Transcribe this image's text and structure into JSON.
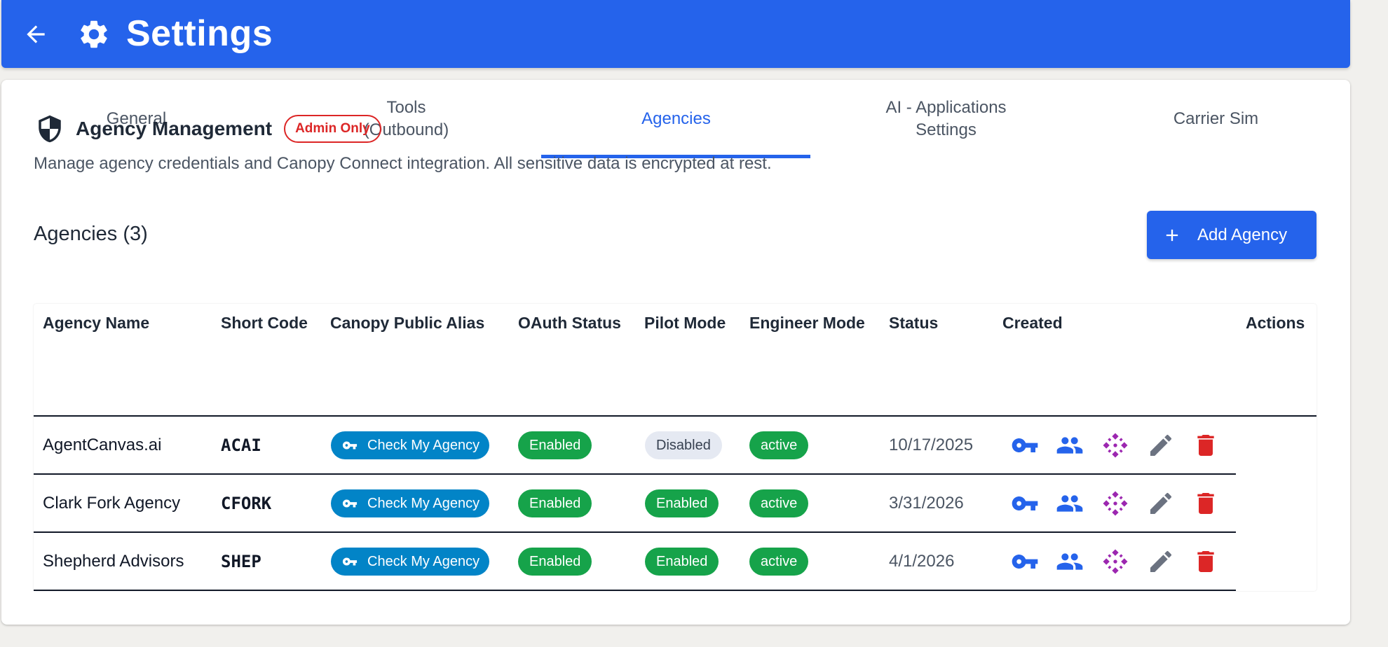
{
  "header": {
    "title": "Settings"
  },
  "tabs": [
    {
      "label": "General"
    },
    {
      "label": "Tools\n(Outbound)"
    },
    {
      "label": "Agencies"
    },
    {
      "label": "AI - Applications\nSettings"
    },
    {
      "label": "Carrier Sim"
    }
  ],
  "section": {
    "title": "Agency Management",
    "badge": "Admin Only",
    "description": "Manage agency credentials and Canopy Connect integration. All sensitive data is encrypted at rest."
  },
  "agencies": {
    "count_label": "Agencies (3)",
    "add_label": "Add Agency",
    "columns": [
      "Agency Name",
      "Short Code",
      "Canopy Public Alias",
      "OAuth Status",
      "Pilot Mode",
      "Engineer Mode",
      "Status",
      "Created",
      "Actions"
    ],
    "rows": [
      {
        "name": "AgentCanvas.ai",
        "code": "ACAI",
        "alias": "Check My Agency",
        "oauth": "Enabled",
        "pilot": "Disabled",
        "engineer": "active",
        "created": "10/17/2025"
      },
      {
        "name": "Clark Fork Agency",
        "code": "CFORK",
        "alias": "Check My Agency",
        "oauth": "Enabled",
        "pilot": "Enabled",
        "engineer": "active",
        "created": "3/31/2026"
      },
      {
        "name": "Shepherd Advisors",
        "code": "SHEP",
        "alias": "Check My Agency",
        "oauth": "Enabled",
        "pilot": "Enabled",
        "engineer": "active",
        "created": "4/1/2026"
      }
    ]
  },
  "colors": {
    "primary": "#2563eb",
    "success": "#16a34a",
    "danger": "#dc2626",
    "alias": "#0284c7",
    "purple": "#9c27b0"
  },
  "icons": [
    "back-arrow-icon",
    "gear-icon",
    "shield-icon",
    "plus-icon",
    "key-icon",
    "people-icon",
    "integration-icon",
    "pencil-icon",
    "trash-icon"
  ]
}
